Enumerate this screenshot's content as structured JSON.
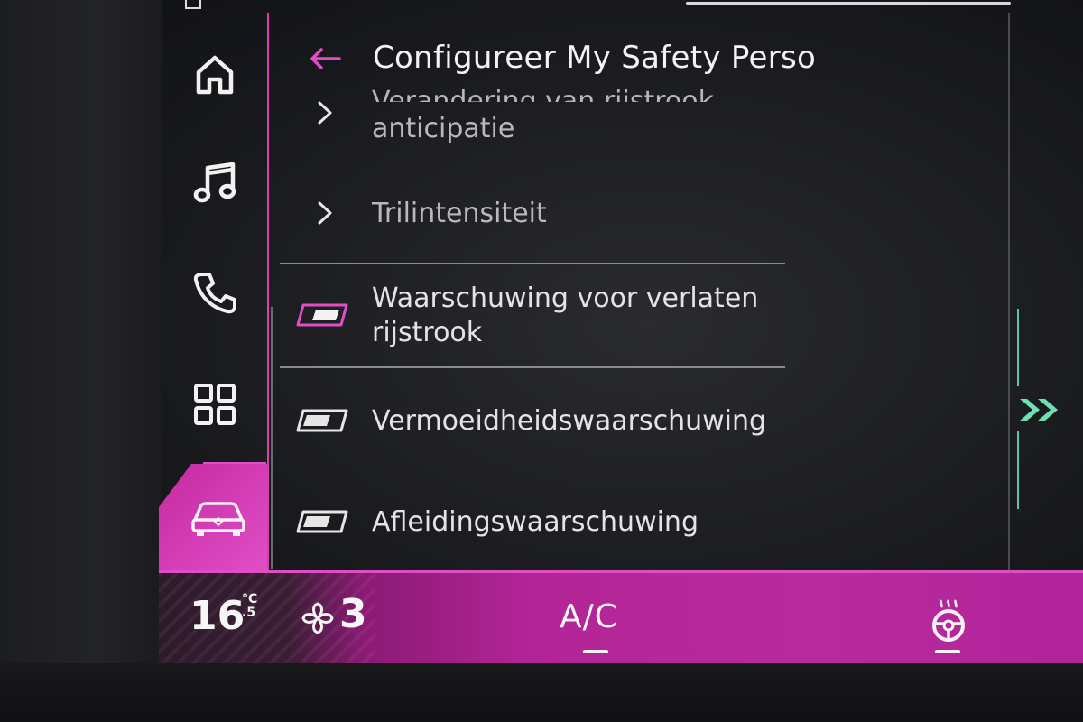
{
  "header": {
    "title": "Configureer My Safety Perso",
    "back_icon": "back-arrow-icon"
  },
  "sidebar": {
    "items": [
      {
        "name": "home",
        "icon": "home-icon"
      },
      {
        "name": "music",
        "icon": "music-note-icon"
      },
      {
        "name": "phone",
        "icon": "phone-icon"
      },
      {
        "name": "apps",
        "icon": "apps-grid-icon"
      },
      {
        "name": "vehicle",
        "icon": "car-icon",
        "active": true
      }
    ]
  },
  "list": {
    "items": [
      {
        "label_cut": "Verandering van rijstrook",
        "label": "anticipatie",
        "type": "submenu"
      },
      {
        "label": "Trilintensiteit",
        "type": "submenu"
      },
      {
        "label": "Waarschuwing voor verlaten rijstrook",
        "type": "toggle",
        "state": "on"
      },
      {
        "label": "Vermoeidheidswaarschuwing",
        "type": "toggle",
        "state": "off"
      },
      {
        "label": "Afleidingswaarschuwing",
        "type": "toggle",
        "state": "off"
      }
    ]
  },
  "climate": {
    "temperature": "16",
    "temp_unit_top": "°C",
    "temp_unit_bottom": ".5",
    "fan_level": "3",
    "ac_label": "A/C",
    "steering_heat_icon": "heated-steering-wheel-icon"
  },
  "colors": {
    "accent": "#d43fb6",
    "accent_light": "#e04ec6",
    "forward_icon": "#6fe0b0"
  }
}
